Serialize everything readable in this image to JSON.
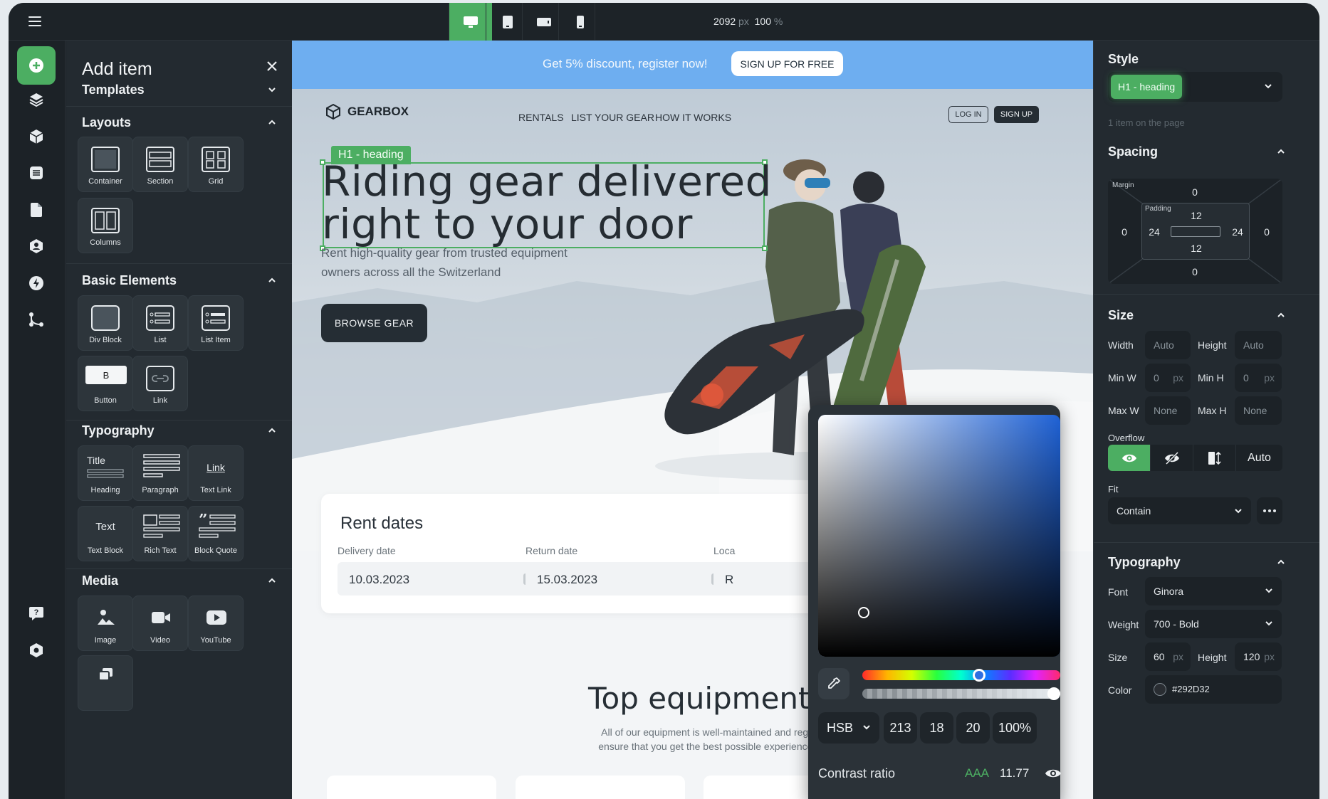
{
  "topbar": {
    "devices": [
      "desktop-icon",
      "tablet-icon",
      "tablet-landscape-icon",
      "mobile-icon"
    ],
    "width_value": "2092",
    "width_unit": "px",
    "zoom_value": "100",
    "zoom_unit": "%"
  },
  "rail": [
    "add-icon",
    "layers-icon",
    "components-icon",
    "pages-icon",
    "assets-icon",
    "users-icon",
    "interactions-icon",
    "flows-icon",
    "help-icon",
    "settings-icon"
  ],
  "add_panel": {
    "title": "Add item",
    "templates": "Templates",
    "layouts": {
      "title": "Layouts",
      "items": [
        "Container",
        "Section",
        "Grid",
        "Columns"
      ]
    },
    "basic": {
      "title": "Basic Elements",
      "items": [
        "Div Block",
        "List",
        "List Item",
        "Button",
        "Link"
      ],
      "button_glyph": "B"
    },
    "typography": {
      "title": "Typography",
      "items": [
        "Heading",
        "Paragraph",
        "Text Link",
        "Text Block",
        "Rich Text",
        "Block Quote"
      ],
      "heading_glyph": "Title",
      "link_glyph": "Link",
      "text_glyph": "Text"
    },
    "media": {
      "title": "Media",
      "items": [
        "Image",
        "Video",
        "YouTube"
      ]
    }
  },
  "canvas": {
    "banner_text": "Get 5% discount, register now!",
    "banner_button": "SIGN UP FOR FREE",
    "brand": "GEARBOX",
    "nav": [
      "RENTALS",
      "LIST YOUR GEAR",
      "HOW IT WORKS"
    ],
    "login": "LOG IN",
    "signup": "SIGN UP",
    "selection_tag": "H1 - heading",
    "h1_line1": "Riding gear delivered",
    "h1_line2": "right to your door",
    "subtext": "Rent high-quality gear from trusted equipment owners across all the Switzerland",
    "browse": "BROWSE GEAR",
    "rent": {
      "title": "Rent dates",
      "delivery_label": "Delivery date",
      "delivery_value": "10.03.2023",
      "return_label": "Return date",
      "return_value": "15.03.2023",
      "location_label": "Loca",
      "location_value": "R"
    },
    "top_title": "Top equipment",
    "top_sub1": "All of our equipment is well-maintained and regularly upd",
    "top_sub2": "ensure that you get the best possible experience on the m"
  },
  "picker": {
    "mode": "HSB",
    "h": "213",
    "s": "18",
    "b": "20",
    "alpha": "100%",
    "hue_fraction": 0.59,
    "alpha_fraction": 1.0,
    "contrast_label": "Contrast ratio",
    "contrast_grade": "AAA",
    "contrast_value": "11.77"
  },
  "style_panel": {
    "style_title": "Style",
    "style_value": "H1 - heading",
    "style_count": "1 item on the page",
    "spacing_title": "Spacing",
    "margin_label": "Margin",
    "padding_label": "Padding",
    "margin": {
      "top": "0",
      "right": "0",
      "bottom": "0",
      "left": "0"
    },
    "padding": {
      "top": "12",
      "right": "24",
      "bottom": "12",
      "left": "24"
    },
    "size_title": "Size",
    "width_label": "Width",
    "width_value": "Auto",
    "height_label": "Height",
    "height_value": "Auto",
    "minw_label": "Min W",
    "minw_value": "0",
    "minw_unit": "px",
    "minh_label": "Min H",
    "minh_value": "0",
    "minh_unit": "px",
    "maxw_label": "Max W",
    "maxw_value": "None",
    "maxh_label": "Max H",
    "maxh_value": "None",
    "overflow_label": "Overflow",
    "overflow_auto": "Auto",
    "fit_label": "Fit",
    "fit_value": "Contain",
    "typo_title": "Typography",
    "font_label": "Font",
    "font_value": "Ginora",
    "weight_label": "Weight",
    "weight_value": "700 - Bold",
    "size_label": "Size",
    "size_value": "60",
    "size_unit": "px",
    "lh_label": "Height",
    "lh_value": "120",
    "lh_unit": "px",
    "color_label": "Color",
    "color_value": "#292D32"
  },
  "colors": {
    "accent": "#4cae62",
    "banner": "#6eaef0",
    "panel": "#232a30"
  }
}
